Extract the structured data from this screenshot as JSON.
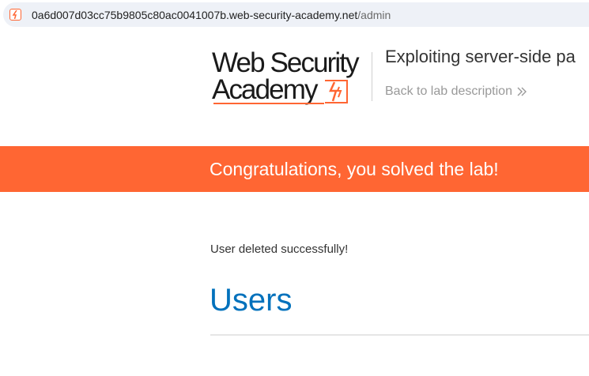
{
  "browser": {
    "url_host": "0a6d007d03cc75b9805c80ac0041007b.web-security-academy.net",
    "url_path": "/admin",
    "site_icon": "portswigger-lab-icon"
  },
  "header": {
    "logo_line1": "Web Security",
    "logo_line2": "Academy",
    "logo_icon": "lightning-bolt-icon",
    "lab_title": "Exploiting server-side pa",
    "back_link": "Back to lab description",
    "back_icon": "double-chevron-right-icon"
  },
  "banner": {
    "text": "Congratulations, you solved the lab!",
    "color": "#ff6633"
  },
  "main": {
    "message": "User deleted successfully!",
    "heading": "Users",
    "heading_color": "#0071bc"
  }
}
